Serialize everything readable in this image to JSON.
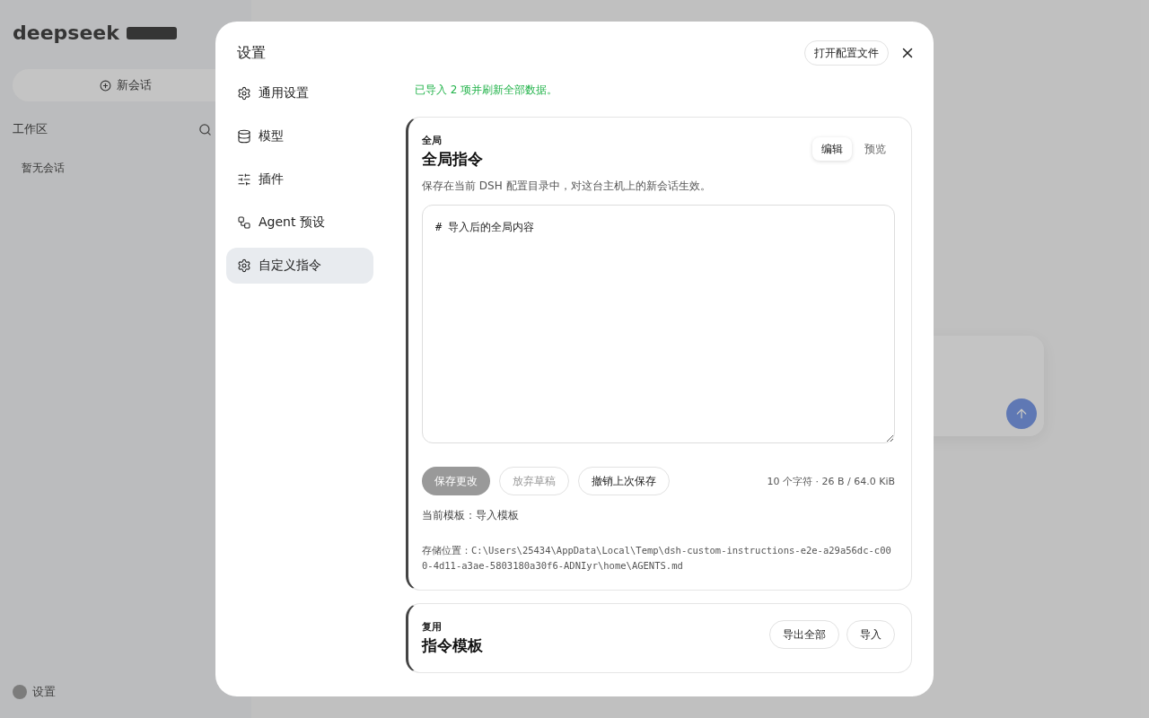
{
  "background": {
    "brand": "deepseek",
    "new_chat": "新会话",
    "workspace_label": "工作区",
    "empty_sessions": "暂无会话",
    "settings_link": "设置"
  },
  "dialog": {
    "title": "设置",
    "open_config_button": "打开配置文件",
    "nav": [
      {
        "label": "通用设置",
        "selected": false
      },
      {
        "label": "模型",
        "selected": false
      },
      {
        "label": "插件",
        "selected": false
      },
      {
        "label": "Agent 预设",
        "selected": false
      },
      {
        "label": "自定义指令",
        "selected": true
      }
    ],
    "notice": "已导入 2 项并刷新全部数据。",
    "global_card": {
      "eyebrow": "全局",
      "title": "全局指令",
      "tabs": [
        {
          "label": "编辑",
          "selected": true
        },
        {
          "label": "预览",
          "selected": false
        }
      ],
      "description": "保存在当前 DSH 配置目录中，对这台主机上的新会话生效。",
      "editor_value": "# 导入后的全局内容",
      "buttons": [
        {
          "label": "保存更改",
          "kind": "primary",
          "disabled": true
        },
        {
          "label": "放弃草稿",
          "kind": "outline",
          "disabled": true
        },
        {
          "label": "撤销上次保存",
          "kind": "outline",
          "disabled": false
        }
      ],
      "stats": "10 个字符 · 26 B / 64.0 KiB",
      "current_template": "当前模板：导入模板",
      "storage_label": "存储位置：",
      "storage_path": "C:\\Users\\25434\\AppData\\Local\\Temp\\dsh-custom-instructions-e2e-a29a56dc-c000-4d11-a3ae-5803180a30f6-ADNIyr\\home\\AGENTS.md"
    },
    "template_card": {
      "eyebrow": "复用",
      "title": "指令模板",
      "buttons": [
        {
          "label": "导出全部"
        },
        {
          "label": "导入"
        }
      ]
    }
  }
}
